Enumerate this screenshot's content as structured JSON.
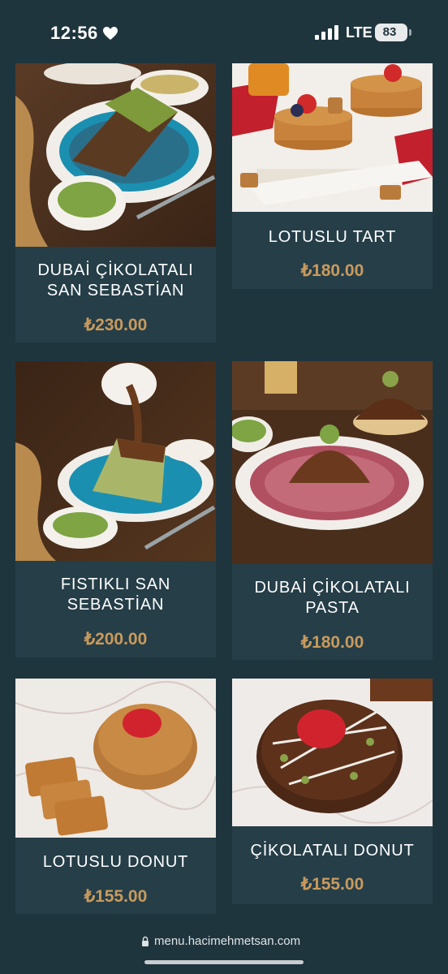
{
  "status_bar": {
    "time": "12:56",
    "network": "LTE",
    "battery": "83"
  },
  "products": [
    {
      "name": "DUBAİ ÇİKOLATALI SAN SEBASTİAN",
      "price": "₺230.00",
      "image_icon": "pistachio-cake-image"
    },
    {
      "name": "LOTUSLU TART",
      "price": "₺180.00",
      "image_icon": "lotus-tart-image"
    },
    {
      "name": "FISTIKLI SAN SEBASTİAN",
      "price": "₺200.00",
      "image_icon": "chocolate-pour-cake-image"
    },
    {
      "name": "DUBAİ ÇİKOLATALI PASTA",
      "price": "₺180.00",
      "image_icon": "chocolate-dome-cake-image"
    },
    {
      "name": "LOTUSLU DONUT",
      "price": "₺155.00",
      "image_icon": "lotus-donut-image"
    },
    {
      "name": "ÇİKOLATALI DONUT",
      "price": "₺155.00",
      "image_icon": "chocolate-donut-image"
    }
  ],
  "browser": {
    "url": "menu.hacimehmetsan.com"
  },
  "colors": {
    "background": "#1f353e",
    "card": "#253e48",
    "price": "#c99a5c",
    "text": "#ffffff"
  }
}
